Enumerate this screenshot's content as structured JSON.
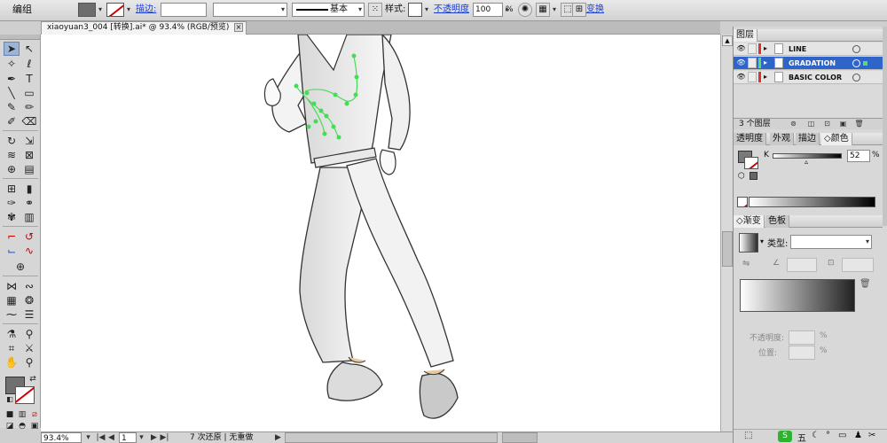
{
  "toolbar": {
    "mode_label": "编组",
    "stroke_label": "描边:",
    "stroke_width": "",
    "stroke_style": "",
    "brush_label": "基本",
    "style_label": "样式:",
    "opacity_label": "不透明度",
    "opacity_value": "100",
    "opacity_unit": "%",
    "transform_label": "变换"
  },
  "document": {
    "tab_title": "xiaoyuan3_004 [转换].ai* @ 93.4% (RGB/预览)",
    "close_glyph": "×"
  },
  "status": {
    "zoom": "93.4%",
    "artboard": "1",
    "info": "7 次还原 | 无重做"
  },
  "layers_panel": {
    "title": "图层",
    "layers": [
      {
        "name": "LINE",
        "color": "#e03030",
        "selected": false
      },
      {
        "name": "GRADATION",
        "color": "#4fe06a",
        "selected": true
      },
      {
        "name": "BASIC COLOR",
        "color": "#e03030",
        "selected": false
      }
    ],
    "count": "3 个图层"
  },
  "color_panel": {
    "tabs": [
      "透明度",
      "外观",
      "描边",
      "颜色"
    ],
    "active_tab": "颜色",
    "channel": "K",
    "value": "52",
    "unit": "%"
  },
  "gradient_panel": {
    "tabs": [
      "渐变",
      "色板"
    ],
    "active_tab": "渐变",
    "type_label": "类型:",
    "type_value": "",
    "opacity_label": "不透明度:",
    "opacity_unit": "%",
    "location_label": "位置:",
    "location_unit": "%"
  },
  "colors": {
    "accent": "#2f64c8",
    "gradient_points": "#4fe06a",
    "link": "#1a3fd1"
  }
}
